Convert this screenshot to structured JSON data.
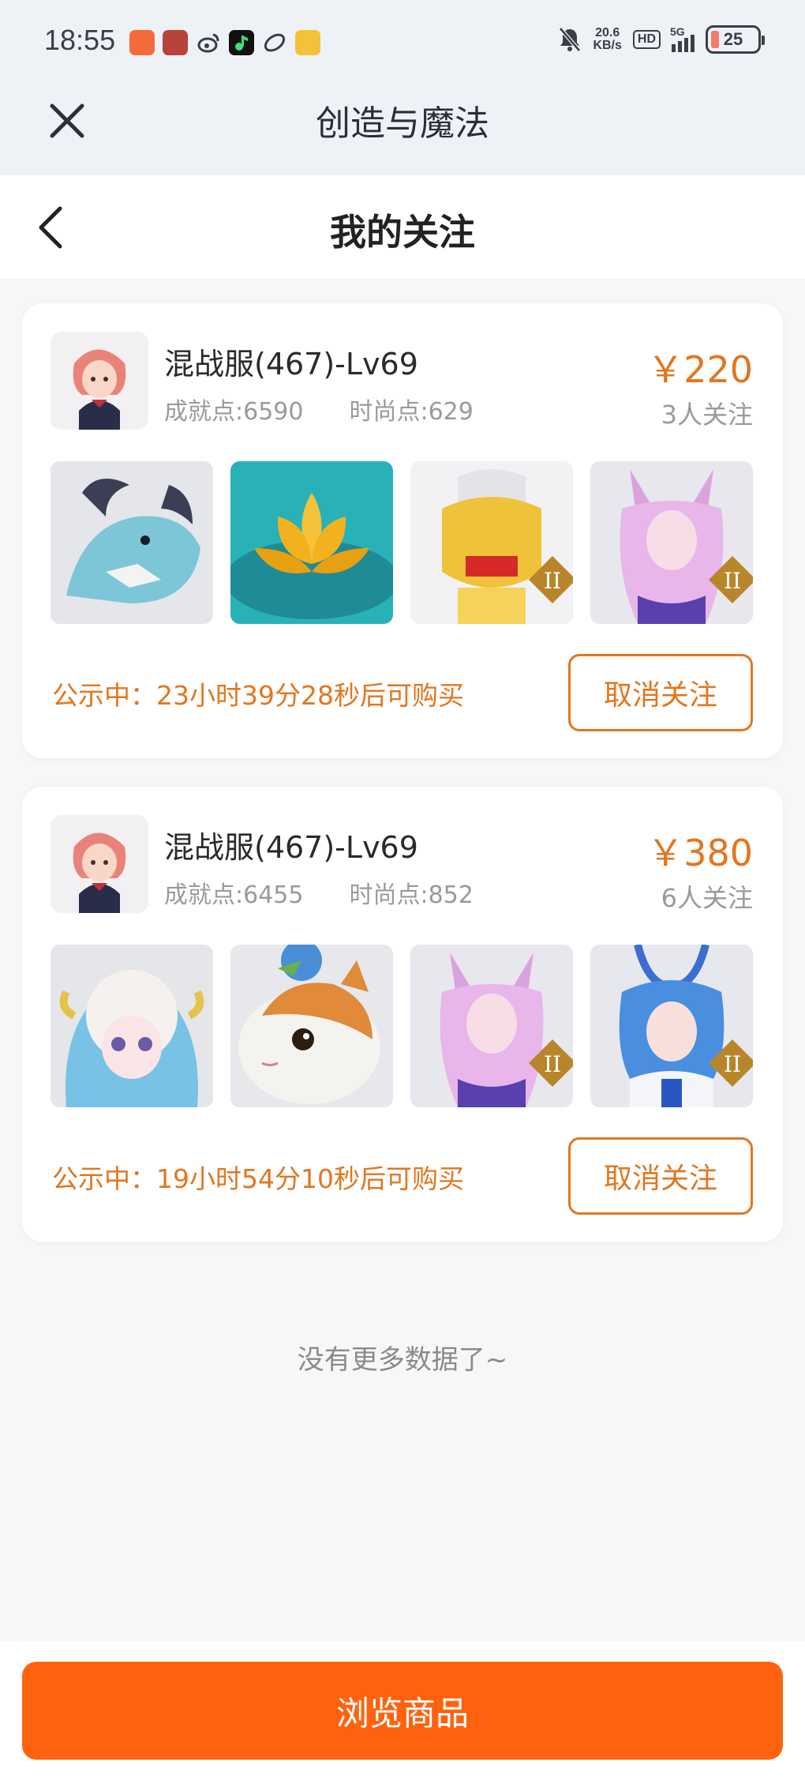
{
  "status_bar": {
    "time": "18:55",
    "speed_value": "20.6",
    "speed_unit": "KB/s",
    "hd_label": "HD",
    "network": "5G",
    "battery": "25"
  },
  "app_bar": {
    "title": "创造与魔法"
  },
  "page": {
    "title": "我的关注"
  },
  "listings": [
    {
      "server": "混战服(467)-Lv69",
      "achievement": "成就点:6590",
      "fashion": "时尚点:629",
      "price": "￥220",
      "follow_count": "3人关注",
      "notice": "公示中：23小时39分28秒后可购买",
      "unfollow_label": "取消关注"
    },
    {
      "server": "混战服(467)-Lv69",
      "achievement": "成就点:6455",
      "fashion": "时尚点:852",
      "price": "￥380",
      "follow_count": "6人关注",
      "notice": "公示中：19小时54分10秒后可购买",
      "unfollow_label": "取消关注"
    }
  ],
  "footer": {
    "no_more": "没有更多数据了~",
    "browse_label": "浏览商品"
  },
  "colors": {
    "accent": "#e2761f",
    "primary_button": "#ff620f"
  }
}
